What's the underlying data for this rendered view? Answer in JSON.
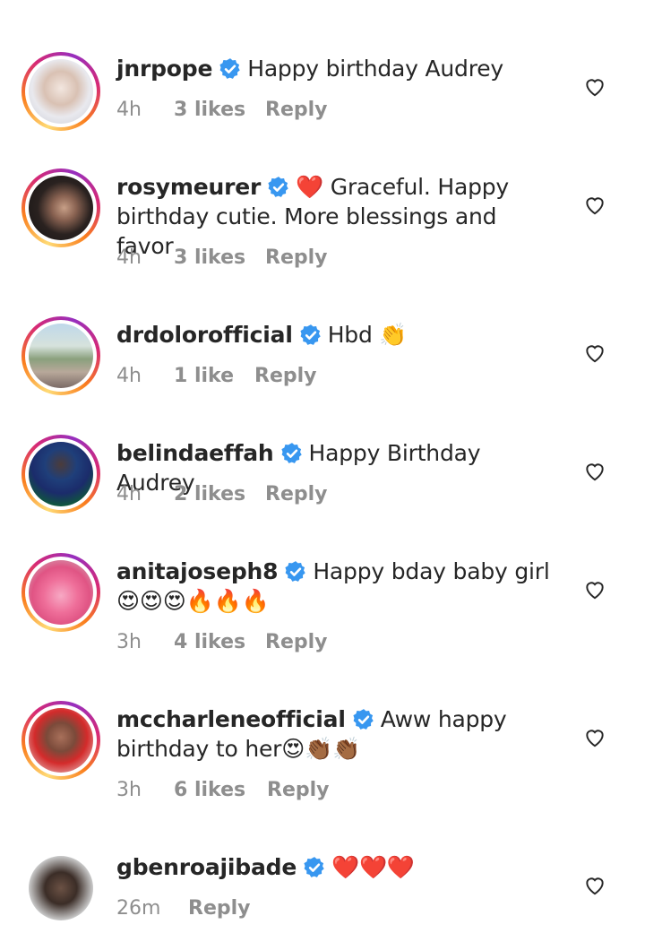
{
  "comments": [
    {
      "username": "jnrpope",
      "text": "Happy birthday Audrey",
      "time": "4h",
      "likes": "3 likes",
      "reply": "Reply"
    },
    {
      "username": "rosymeurer",
      "text": "❤️ Graceful. Happy birthday cutie. More blessings and favor",
      "time": "4h",
      "likes": "3 likes",
      "reply": "Reply"
    },
    {
      "username": "drdolorofficial",
      "text": "Hbd 👏",
      "time": "4h",
      "likes": "1 like",
      "reply": "Reply"
    },
    {
      "username": "belindaeffah",
      "text": "Happy Birthday Audrey",
      "time": "4h",
      "likes": "2 likes",
      "reply": "Reply"
    },
    {
      "username": "anitajoseph8",
      "text": "Happy bday baby girl 😍😍😍🔥🔥🔥",
      "time": "3h",
      "likes": "4 likes",
      "reply": "Reply"
    },
    {
      "username": "mccharleneofficial",
      "text": "Aww happy birthday to her😍👏🏾👏🏾",
      "time": "3h",
      "likes": "6 likes",
      "reply": "Reply"
    },
    {
      "username": "gbenroajibade",
      "text": "❤️❤️❤️",
      "time": "26m",
      "likes": "",
      "reply": "Reply"
    }
  ],
  "icons": {
    "verified": "verified-badge-icon",
    "like": "heart-outline-icon"
  },
  "colors": {
    "verified": "#3897f0",
    "meta": "#8e8e8e",
    "text": "#262626"
  }
}
